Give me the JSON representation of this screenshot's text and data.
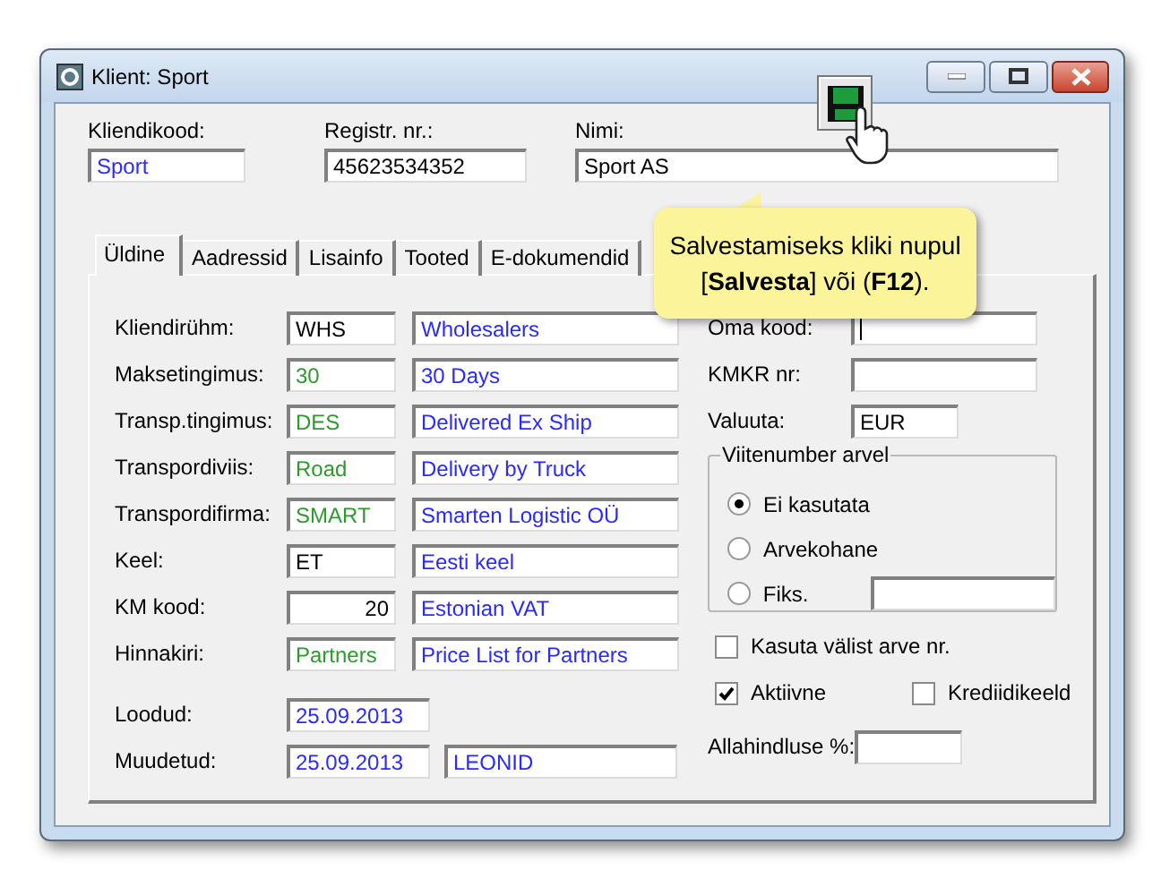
{
  "window": {
    "title": "Klient: Sport"
  },
  "header_fields": [
    {
      "label": "Kliendikood:",
      "value": "Sport",
      "kind": "link"
    },
    {
      "label": "Registr. nr.:",
      "value": "45623534352",
      "kind": "plain"
    },
    {
      "label": "Nimi:",
      "value": "Sport AS",
      "kind": "plain"
    }
  ],
  "save_button": {
    "tooltip": "Salvestamiseks kliki nupul [**Salvesta**] või (**F12**)."
  },
  "tabs": [
    {
      "label": "Üldine",
      "selected": true
    },
    {
      "label": "Aadressid",
      "selected": false
    },
    {
      "label": "Lisainfo",
      "selected": false
    },
    {
      "label": "Tooted",
      "selected": false
    },
    {
      "label": "E-dokumendid",
      "selected": false
    }
  ],
  "rows": [
    {
      "label": "Kliendirühm:",
      "code": {
        "value": "WHS",
        "kind": "plain"
      },
      "name": {
        "value": "Wholesalers",
        "kind": "link"
      }
    },
    {
      "label": "Maksetingimus:",
      "code": {
        "value": "30",
        "kind": "lookup"
      },
      "name": {
        "value": "30 Days",
        "kind": "link"
      }
    },
    {
      "label": "Transp.tingimus:",
      "code": {
        "value": "DES",
        "kind": "lookup"
      },
      "name": {
        "value": "Delivered Ex Ship",
        "kind": "link"
      }
    },
    {
      "label": "Transpordiviis:",
      "code": {
        "value": "Road",
        "kind": "lookup"
      },
      "name": {
        "value": "Delivery by Truck",
        "kind": "link"
      }
    },
    {
      "label": "Transpordifirma:",
      "code": {
        "value": "SMART",
        "kind": "lookup"
      },
      "name": {
        "value": "Smarten Logistic OÜ",
        "kind": "link"
      }
    },
    {
      "label": "Keel:",
      "code": {
        "value": "ET",
        "kind": "plain"
      },
      "name": {
        "value": "Eesti keel",
        "kind": "link"
      }
    },
    {
      "label": "KM kood:",
      "code": {
        "value": "20",
        "kind": "number"
      },
      "name": {
        "value": "Estonian VAT",
        "kind": "link"
      }
    },
    {
      "label": "Hinnakiri:",
      "code": {
        "value": "Partners",
        "kind": "lookup"
      },
      "name": {
        "value": "Price List for Partners",
        "kind": "link"
      }
    }
  ],
  "dates": [
    {
      "label": "Loodud:",
      "date": "25.09.2013"
    },
    {
      "label": "Muudetud:",
      "date": "25.09.2013",
      "user": "LEONID"
    }
  ],
  "right_fields": [
    {
      "label": "Oma kood:",
      "focused": true,
      "kind": "wide"
    },
    {
      "label": "KMKR nr:",
      "focused": false,
      "kind": "wide"
    },
    {
      "label": "Valuuta:",
      "value": "EUR",
      "focused": false,
      "kind": "short"
    }
  ],
  "reference_group": {
    "title": "Viitenumber arvel",
    "options": [
      {
        "label": "Ei kasutata",
        "selected": true,
        "kind": "plain"
      },
      {
        "label": "Arvekohane",
        "selected": false,
        "kind": "plain"
      },
      {
        "label": "Fiks.",
        "selected": false,
        "kind": "with_field"
      }
    ]
  },
  "checkboxes": [
    {
      "label": "Kasuta välist arve nr.",
      "checked": false
    },
    {
      "label": "Aktiivne",
      "checked": true
    },
    {
      "label": "Krediidikeeld",
      "checked": false
    }
  ],
  "discount": {
    "label": "Allahindluse %:"
  }
}
